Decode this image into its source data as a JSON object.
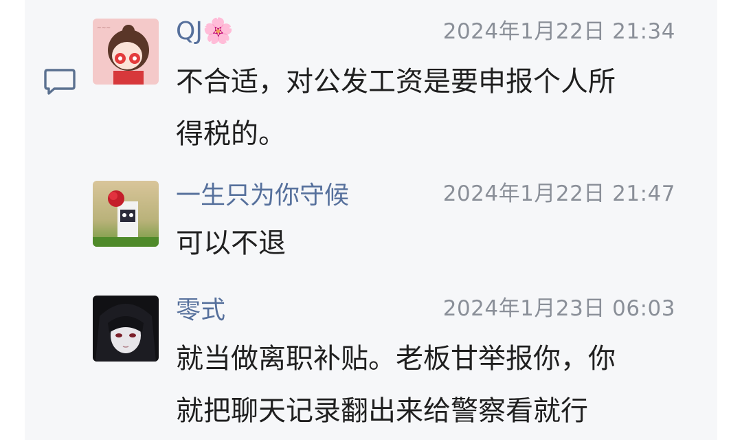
{
  "comments": [
    {
      "name": "QJ🌸",
      "time": "2024年1月22日 21:34",
      "text_lines": [
        "不合适，对公发工资是要申报个人所",
        "得税的。"
      ]
    },
    {
      "name": "一生只为你守候",
      "time": "2024年1月22日 21:47",
      "text_lines": [
        "可以不退"
      ]
    },
    {
      "name": "零式",
      "time": "2024年1月23日 06:03",
      "text_lines": [
        "就当做离职补贴。老板甘举报你，你",
        "就把聊天记录翻出来给警察看就行"
      ]
    }
  ],
  "colors": {
    "panel_bg": "#f6f7f9",
    "name": "#56709c",
    "time": "#8a8f98",
    "text": "#1f1f1f"
  },
  "icons": {
    "reply": "comment-bubble-icon"
  }
}
